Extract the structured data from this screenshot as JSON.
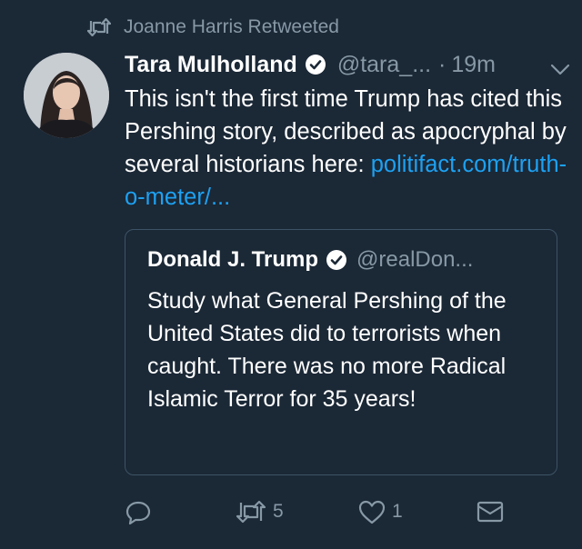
{
  "context": {
    "retweeted_by": "Joanne Harris Retweeted"
  },
  "tweet": {
    "author_name": "Tara Mulholland",
    "author_handle": "@tara_...",
    "separator": "·",
    "time": "19m",
    "text": "This isn't the first time Trump has cited this Pershing story, described as apocryphal by several historians here: ",
    "link_text": "politifact.com/truth-o-meter/...",
    "link_color": "#1da1f2"
  },
  "quoted_tweet": {
    "author_name": "Donald J. Trump",
    "author_handle": "@realDon...",
    "text": "Study what General Pershing of the United States did to terrorists when caught. There was no more Radical Islamic Terror for 35 years!"
  },
  "actions": {
    "reply_icon": "reply-icon",
    "retweet_icon": "retweet-icon",
    "retweet_count": "5",
    "like_icon": "heart-icon",
    "like_count": "1",
    "message_icon": "envelope-icon"
  },
  "colors": {
    "background": "#1b2836",
    "secondary_text": "#8899a6",
    "border": "#3d5466"
  }
}
